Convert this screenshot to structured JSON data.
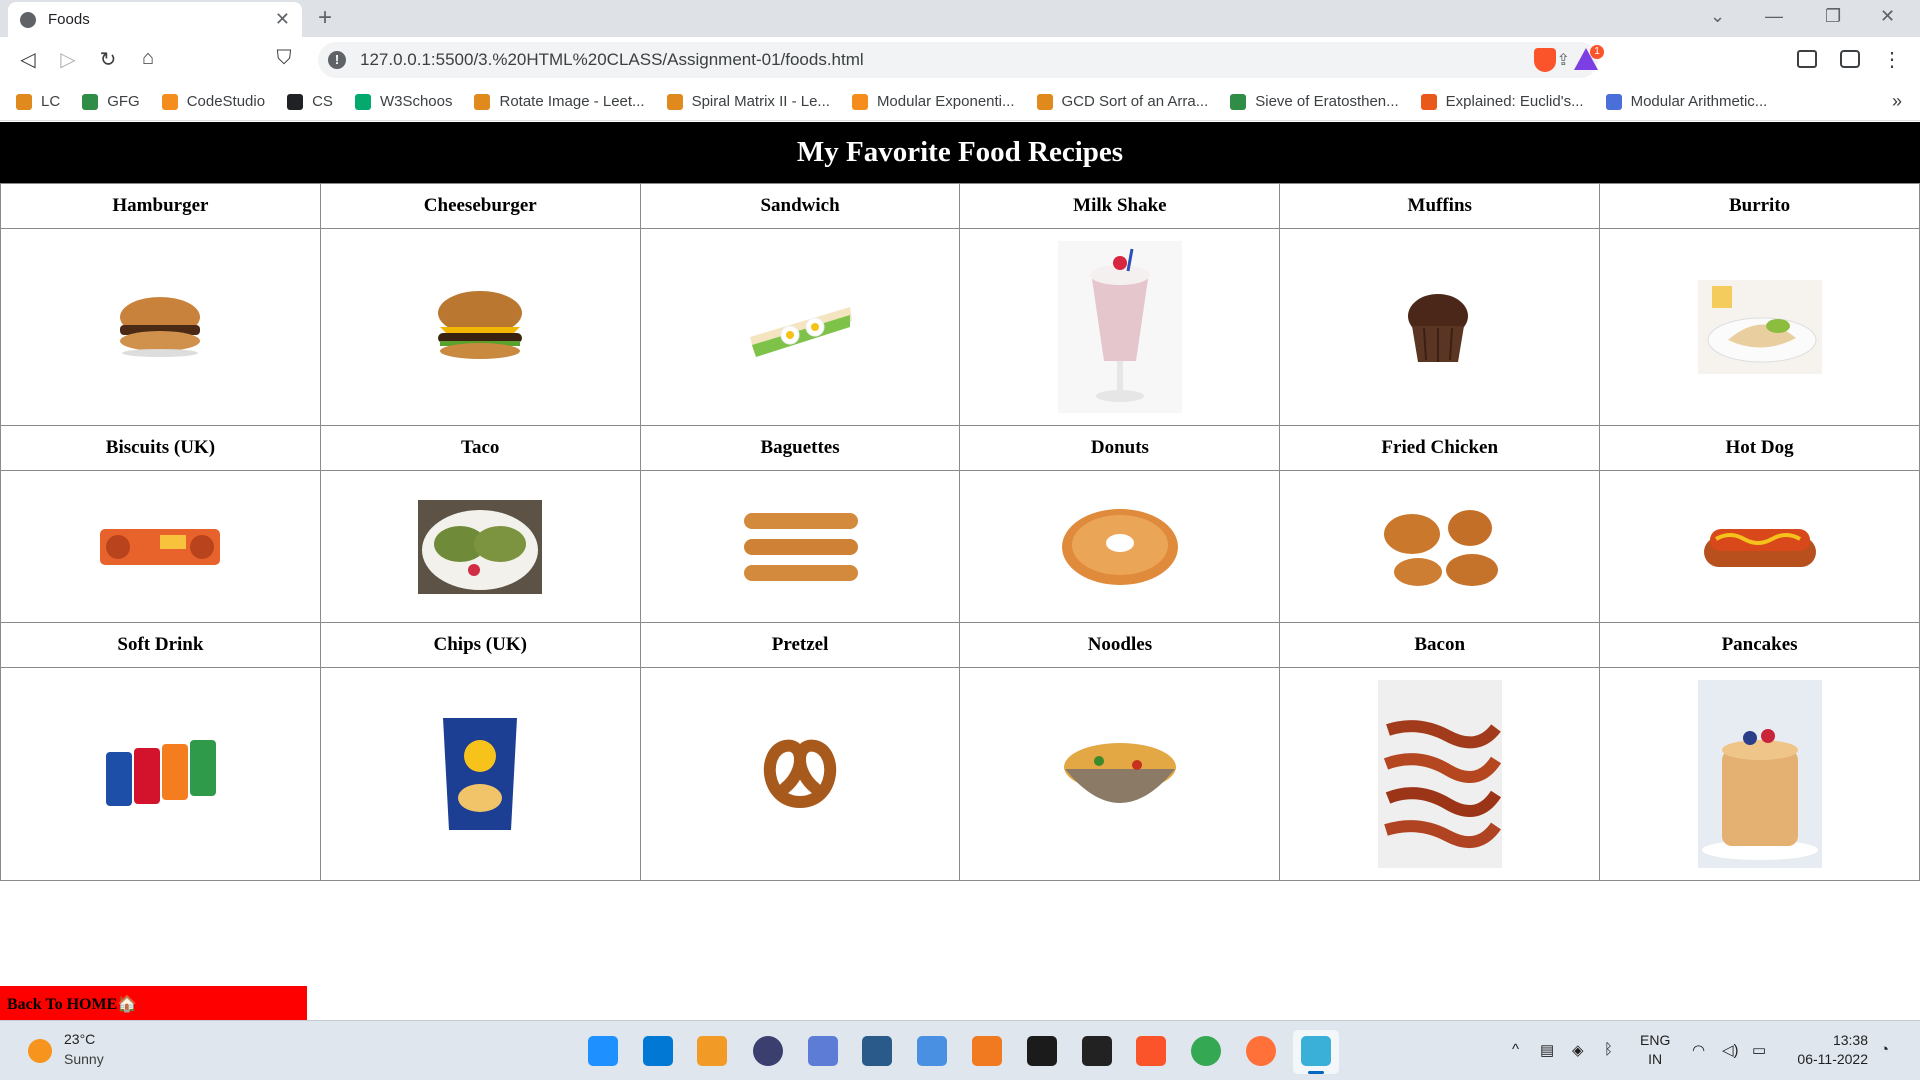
{
  "browser": {
    "tab_title": "Foods",
    "tab_close": "✕",
    "new_tab": "+",
    "url": "127.0.0.1:5500/3.%20HTML%20CLASS/Assignment-01/foods.html",
    "bookmarks": [
      {
        "label": "LC",
        "icon": "leetcode-icon",
        "color": "#e08a1e"
      },
      {
        "label": "GFG",
        "icon": "gfg-icon",
        "color": "#2f8d46"
      },
      {
        "label": "CodeStudio",
        "icon": "codestudio-icon",
        "color": "#f58d1e"
      },
      {
        "label": "CS",
        "icon": "code-icon",
        "color": "#202124"
      },
      {
        "label": "W3Schoos",
        "icon": "w3schools-icon",
        "color": "#04aa6d"
      },
      {
        "label": "Rotate Image - Leet...",
        "icon": "leetcode-icon",
        "color": "#e08a1e"
      },
      {
        "label": "Spiral Matrix II - Le...",
        "icon": "leetcode-icon",
        "color": "#e08a1e"
      },
      {
        "label": "Modular Exponenti...",
        "icon": "codestudio-icon",
        "color": "#f58d1e"
      },
      {
        "label": "GCD Sort of an Arra...",
        "icon": "leetcode-icon",
        "color": "#e08a1e"
      },
      {
        "label": "Sieve of Eratosthen...",
        "icon": "gfg-icon",
        "color": "#2f8d46"
      },
      {
        "label": "Explained: Euclid's...",
        "icon": "medium-icon",
        "color": "#e8591a"
      },
      {
        "label": "Modular Arithmetic...",
        "icon": "chart-icon",
        "color": "#4a6fd8"
      }
    ],
    "bookmarks_more": "»"
  },
  "page": {
    "heading": "My Favorite Food Recipes",
    "back_home": "Back To HOME🏠",
    "rows": [
      {
        "names": [
          "Hamburger",
          "Cheeseburger",
          "Sandwich",
          "Milk Shake",
          "Muffins",
          "Burrito"
        ],
        "icons": [
          "hamburger-image",
          "cheeseburger-image",
          "sandwich-image",
          "milkshake-image",
          "muffin-image",
          "burrito-image"
        ]
      },
      {
        "names": [
          "Biscuits (UK)",
          "Taco",
          "Baguettes",
          "Donuts",
          "Fried Chicken",
          "Hot Dog"
        ],
        "icons": [
          "biscuits-image",
          "taco-image",
          "baguettes-image",
          "donut-image",
          "fried-chicken-image",
          "hotdog-image"
        ]
      },
      {
        "names": [
          "Soft Drink",
          "Chips (UK)",
          "Pretzel",
          "Noodles",
          "Bacon",
          "Pancakes"
        ],
        "icons": [
          "soft-drink-image",
          "chips-image",
          "pretzel-image",
          "noodles-image",
          "bacon-image",
          "pancakes-image"
        ]
      }
    ]
  },
  "taskbar": {
    "temperature": "23°C",
    "condition": "Sunny",
    "lang_top": "ENG",
    "lang_bottom": "IN",
    "time": "13:38",
    "date": "06-11-2022"
  },
  "colors": {
    "banner_bg": "#000000",
    "back_home_bg": "#ff0000",
    "taskbar_bg": "#dfe6ee"
  }
}
